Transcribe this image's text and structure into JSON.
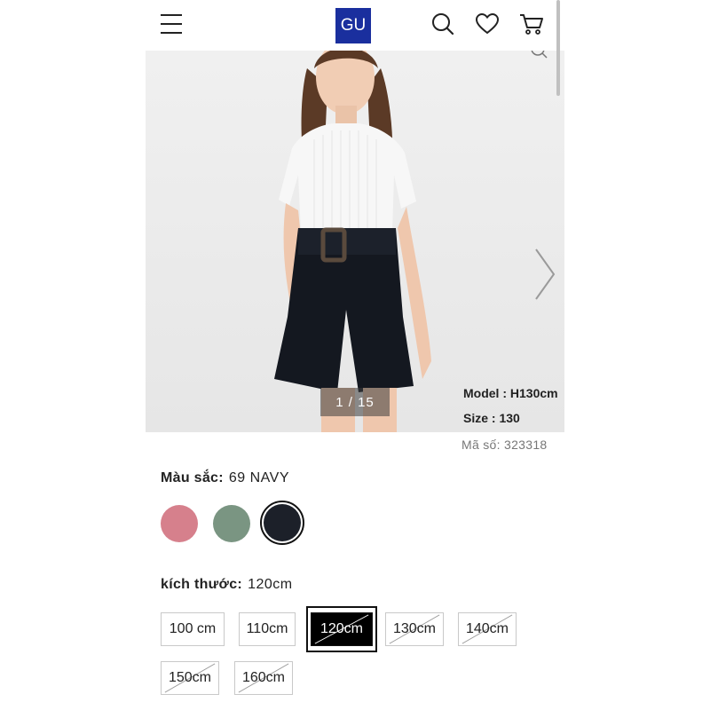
{
  "header": {
    "menu_icon": "hamburger-menu-icon",
    "logo_text": "GU",
    "brand_color": "#1a2f9e",
    "icons": [
      "search-icon",
      "heart-icon",
      "cart-icon"
    ]
  },
  "gallery": {
    "counter": "1 / 15",
    "model": "Model : H130cm",
    "size": "Size : 130",
    "next_icon": "chevron-right-icon",
    "zoom_icon": "zoom-icon"
  },
  "product": {
    "code": "Mã số: 323318"
  },
  "color": {
    "label": "Màu sắc:",
    "selected": "69 NAVY",
    "swatches": [
      {
        "name": "pink",
        "hex": "#d6808c"
      },
      {
        "name": "green",
        "hex": "#7a9582"
      },
      {
        "name": "navy",
        "hex": "#1c2029",
        "selected": true
      }
    ]
  },
  "size": {
    "label": "kích thước:",
    "selected": "120cm",
    "options": [
      {
        "label": "100 cm",
        "available": true
      },
      {
        "label": "110cm",
        "available": true
      },
      {
        "label": "120cm",
        "available": false,
        "selected": true
      },
      {
        "label": "130cm",
        "available": false
      },
      {
        "label": "140cm",
        "available": false
      },
      {
        "label": "150cm",
        "available": false
      },
      {
        "label": "160cm",
        "available": false
      }
    ]
  }
}
